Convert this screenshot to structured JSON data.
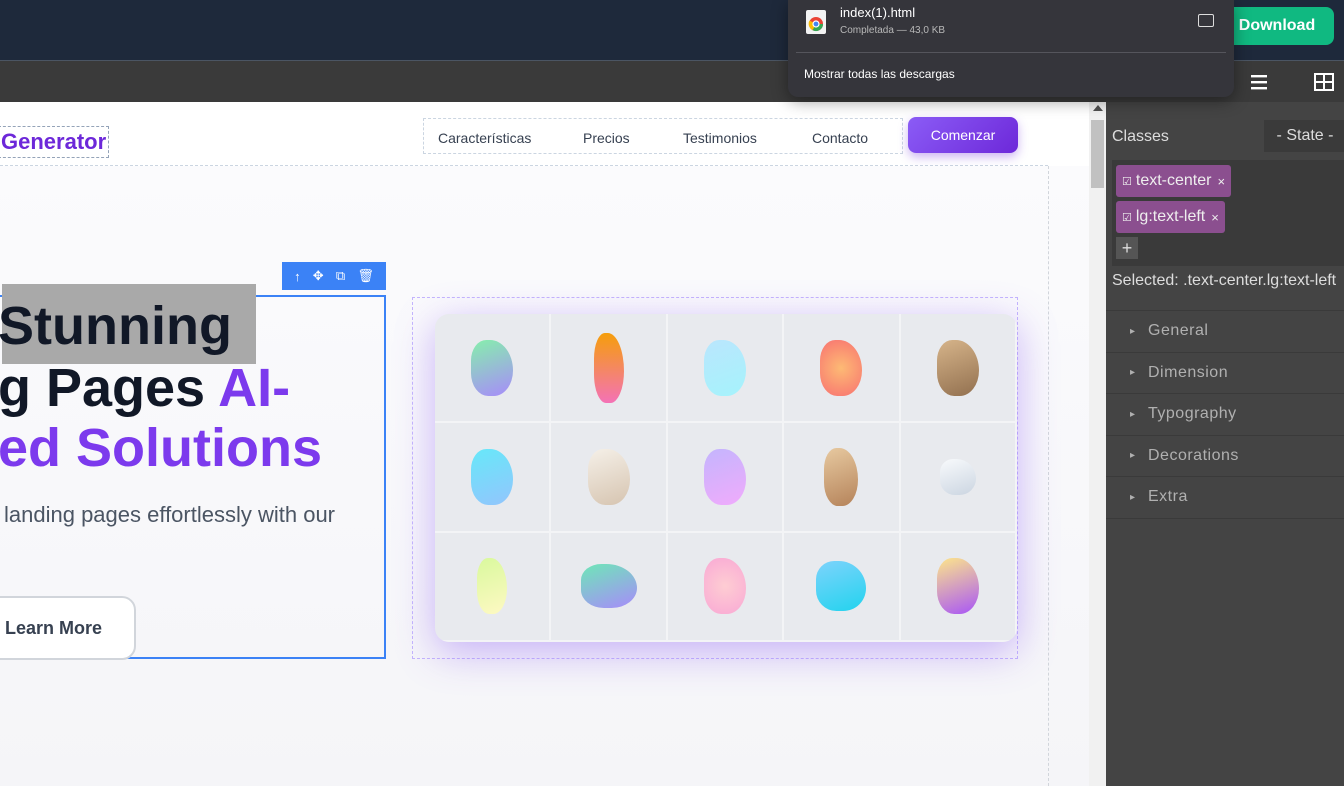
{
  "topbar": {
    "download_label": "Download"
  },
  "download_popup": {
    "file_name": "index(1).html",
    "status": "Completada — 43,0 KB",
    "show_all": "Mostrar todas las descargas"
  },
  "site": {
    "logo": "Generator",
    "nav": [
      "Características",
      "Precios",
      "Testimonios",
      "Contacto"
    ],
    "cta": "Comenzar",
    "hero": {
      "line1": "Stunning",
      "line2a": "g Pages ",
      "line2b": "AI-",
      "line3": "ed Solutions",
      "paragraph": "landing pages effortlessly with our",
      "learn_more": "Learn More"
    }
  },
  "panel": {
    "classes_label": "Classes",
    "state_label": "- State -",
    "tags": [
      "text-center",
      "lg:text-left"
    ],
    "add_label": "+",
    "selected_text": "Selected: .text-center.lg:text-left",
    "sectors": [
      "General",
      "Dimension",
      "Typography",
      "Decorations",
      "Extra"
    ]
  },
  "colors": {
    "accent": "#7c3aed",
    "download": "#10b981",
    "selection": "#3b82f6",
    "tag": "#8b4f8f"
  }
}
